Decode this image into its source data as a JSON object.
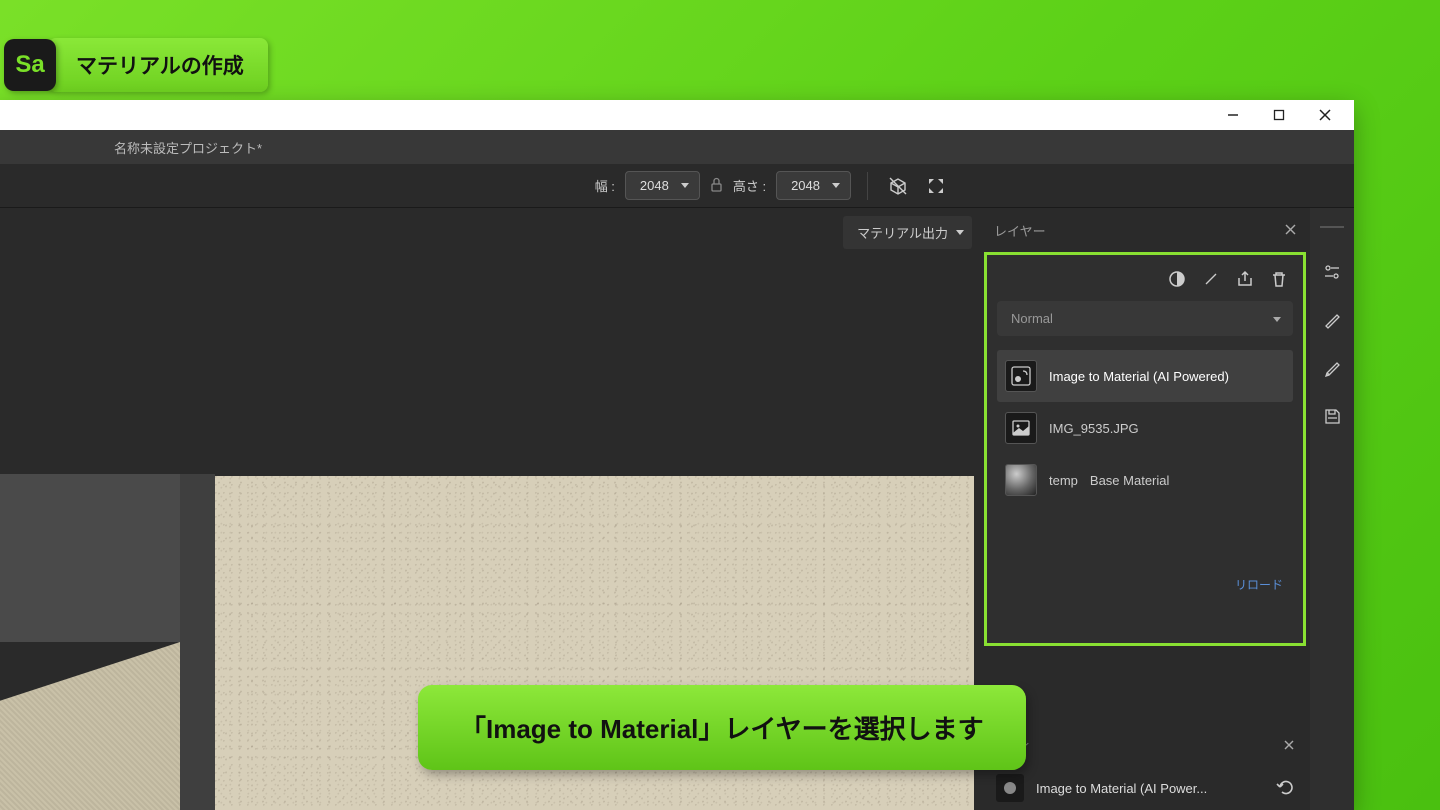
{
  "badge": {
    "icon_text": "Sa",
    "label": "マテリアルの作成"
  },
  "project": {
    "title": "名称未設定プロジェクト*"
  },
  "toolbar": {
    "width_label": "幅 :",
    "width_value": "2048",
    "height_label": "高さ :",
    "height_value": "2048"
  },
  "output_dropdown": "マテリアル出力",
  "layers": {
    "title": "レイヤー",
    "blend_mode": "Normal",
    "items": [
      {
        "name": "Image to Material (AI Powered)",
        "selected": true,
        "thumb": "ai"
      },
      {
        "name": "IMG_9535.JPG",
        "selected": false,
        "thumb": "image"
      },
      {
        "name": "Base Material",
        "selected": false,
        "thumb": "sphere"
      }
    ],
    "reload": "リロード"
  },
  "properties": {
    "title": "パティ",
    "row_label": "Image to Material (AI Power..."
  },
  "caption": "「Image to Material」レイヤーを選択します"
}
